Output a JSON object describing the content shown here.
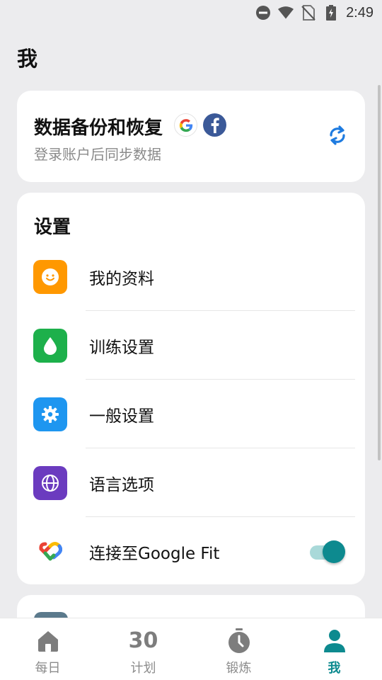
{
  "status_bar": {
    "time": "2:49",
    "icons": [
      "do-not-disturb-icon",
      "wifi-icon",
      "no-sim-icon",
      "battery-charging-icon"
    ]
  },
  "page": {
    "title": "我"
  },
  "backup": {
    "title": "数据备份和恢复",
    "subtitle": "登录账户后同步数据",
    "brands": [
      "google-icon",
      "facebook-icon"
    ],
    "action_icon": "sync-icon"
  },
  "settings": {
    "title": "设置",
    "items": [
      {
        "label": "我的资料",
        "icon": "smiley-icon",
        "color": "#ff9800"
      },
      {
        "label": "训练设置",
        "icon": "drop-icon",
        "color": "#1db04b"
      },
      {
        "label": "一般设置",
        "icon": "gear-icon",
        "color": "#1e96f0"
      },
      {
        "label": "语言选项",
        "icon": "globe-icon",
        "color": "#6b3bbf"
      },
      {
        "label": "连接至Google Fit",
        "icon": "google-fit-icon",
        "toggle": true,
        "toggle_on": true
      }
    ]
  },
  "nav": {
    "items": [
      {
        "label": "每日",
        "icon": "home-icon",
        "active": false
      },
      {
        "label": "计划",
        "icon": "calendar-30-icon",
        "number": "30",
        "active": false
      },
      {
        "label": "锻炼",
        "icon": "stopwatch-icon",
        "active": false
      },
      {
        "label": "我",
        "icon": "profile-icon",
        "active": true
      }
    ]
  },
  "colors": {
    "accent": "#0d8a8f",
    "background": "#ececee",
    "card": "#ffffff",
    "muted_text": "#8a8a8a"
  }
}
